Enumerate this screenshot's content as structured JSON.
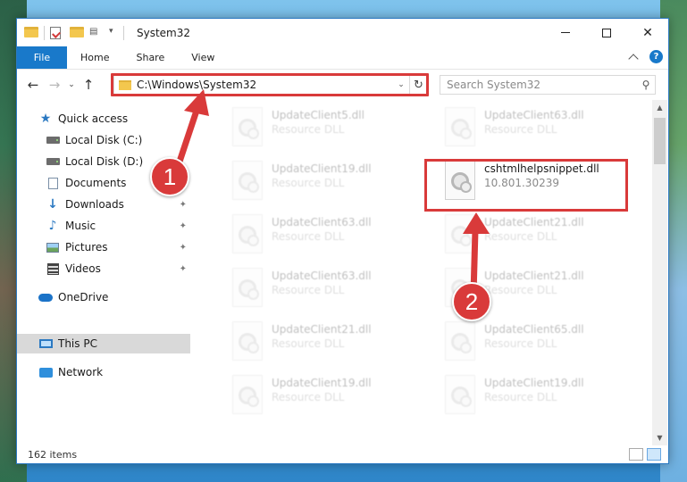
{
  "window": {
    "title": "System32",
    "controls": {
      "minimize": "minimize",
      "maximize": "maximize",
      "close": "✕"
    }
  },
  "ribbon": {
    "file_tab": "File",
    "tabs": [
      "Home",
      "Share",
      "View"
    ],
    "help": "?"
  },
  "nav": {
    "back": "←",
    "forward": "→",
    "recent": "⌄",
    "up": "↑",
    "address": "C:\\Windows\\System32",
    "address_chevron": "⌄",
    "refresh": "↻",
    "search_placeholder": "Search System32",
    "search_icon": "⚲"
  },
  "sidebar": {
    "items": [
      {
        "label": "Quick access",
        "icon": "star-icon",
        "pinned": false
      },
      {
        "label": "Local Disk (C:)",
        "icon": "disk-icon",
        "pinned": false
      },
      {
        "label": "Local Disk (D:)",
        "icon": "disk-icon",
        "pinned": false
      },
      {
        "label": "Documents",
        "icon": "document-icon",
        "pinned": true
      },
      {
        "label": "Downloads",
        "icon": "download-icon",
        "pinned": true
      },
      {
        "label": "Music",
        "icon": "music-icon",
        "pinned": true
      },
      {
        "label": "Pictures",
        "icon": "pictures-icon",
        "pinned": true
      },
      {
        "label": "Videos",
        "icon": "videos-icon",
        "pinned": true
      },
      {
        "label": "OneDrive",
        "icon": "cloud-icon",
        "pinned": false
      },
      {
        "label": "This PC",
        "icon": "computer-icon",
        "pinned": false,
        "selected": true
      },
      {
        "label": "Network",
        "icon": "network-icon",
        "pinned": false
      }
    ],
    "pin_glyph": "📌"
  },
  "files": {
    "left_column": [
      {
        "name": "UpdateClient5.dll",
        "desc": "Resource DLL"
      },
      {
        "name": "UpdateClient19.dll",
        "desc": "Resource DLL"
      },
      {
        "name": "UpdateClient63.dll",
        "desc": "Resource DLL"
      },
      {
        "name": "UpdateClient63.dll",
        "desc": "Resource DLL"
      },
      {
        "name": "UpdateClient21.dll",
        "desc": "Resource DLL"
      },
      {
        "name": "UpdateClient19.dll",
        "desc": "Resource DLL"
      }
    ],
    "right_column": [
      {
        "name": "UpdateClient63.dll",
        "desc": "Resource DLL"
      },
      {
        "name": "cshtmlhelpsnippet.dll",
        "desc": "10.801.30239",
        "highlighted": true
      },
      {
        "name": "UpdateClient21.dll",
        "desc": "Resource DLL"
      },
      {
        "name": "UpdateClient21.dll",
        "desc": "Resource DLL"
      },
      {
        "name": "UpdateClient65.dll",
        "desc": "Resource DLL"
      },
      {
        "name": "UpdateClient19.dll",
        "desc": "Resource DLL"
      }
    ]
  },
  "status": {
    "item_count": "162 items"
  },
  "annotations": {
    "step1": "1",
    "step2": "2",
    "accent": "#d93a3a"
  }
}
